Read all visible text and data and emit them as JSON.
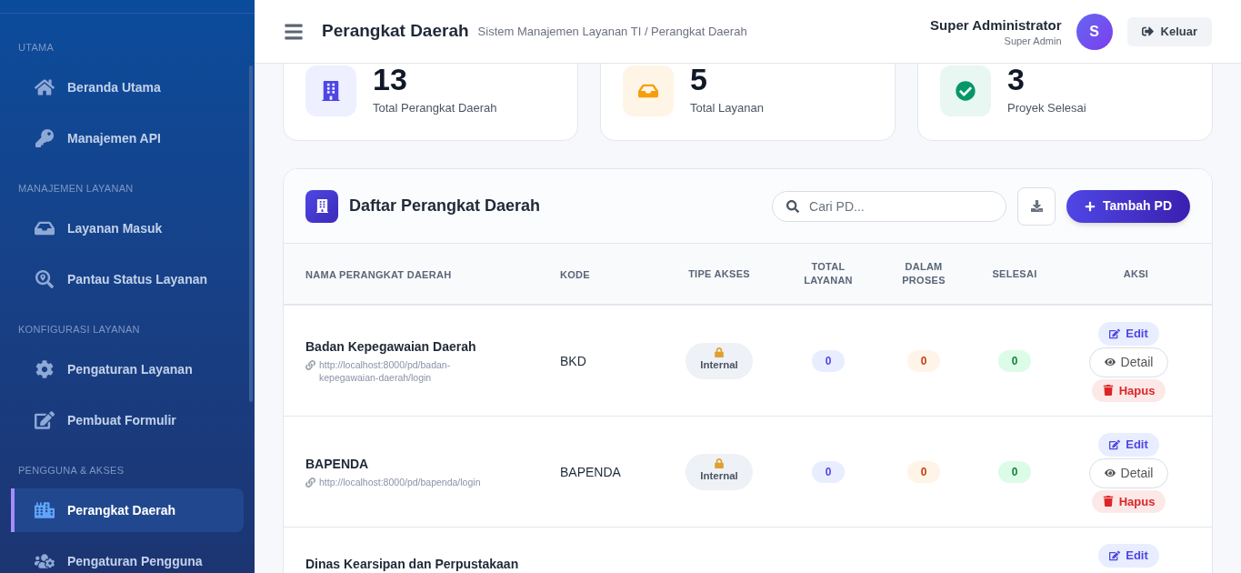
{
  "sidebar": {
    "sections": [
      {
        "label": "UTAMA",
        "items": [
          {
            "label": "Beranda Utama",
            "selected": false
          },
          {
            "label": "Manajemen API",
            "selected": false
          }
        ]
      },
      {
        "label": "MANAJEMEN LAYANAN",
        "items": [
          {
            "label": "Layanan Masuk",
            "selected": false
          },
          {
            "label": "Pantau Status Layanan",
            "selected": false
          }
        ]
      },
      {
        "label": "KONFIGURASI LAYANAN",
        "items": [
          {
            "label": "Pengaturan Layanan",
            "selected": false
          },
          {
            "label": "Pembuat Formulir",
            "selected": false
          }
        ]
      },
      {
        "label": "PENGGUNA & AKSES",
        "items": [
          {
            "label": "Perangkat Daerah",
            "selected": true
          },
          {
            "label": "Pengaturan Pengguna",
            "selected": false
          }
        ]
      }
    ]
  },
  "header": {
    "title": "Perangkat Daerah",
    "breadcrumb": "Sistem Manajemen Layanan TI / Perangkat Daerah",
    "user_name": "Super Administrator",
    "user_role": "Super Admin",
    "avatar": "S",
    "logout": "Keluar"
  },
  "stats": [
    {
      "value": "13",
      "label": "Total Perangkat Daerah"
    },
    {
      "value": "5",
      "label": "Total Layanan"
    },
    {
      "value": "3",
      "label": "Proyek Selesai"
    }
  ],
  "panel": {
    "title": "Daftar Perangkat Daerah",
    "search": {
      "placeholder": "Cari PD..."
    },
    "add_button": "Tambah PD",
    "columns": [
      "NAMA PERANGKAT DAERAH",
      "KODE",
      "TIPE AKSES",
      "TOTAL LAYANAN",
      "DALAM PROSES",
      "SELESAI",
      "AKSI"
    ],
    "rows": [
      {
        "name": "Badan Kepegawaian Daerah",
        "url": "http://localhost:8000/pd/badan-kepegawaian-daerah/login",
        "code": "BKD",
        "access": "Internal",
        "total": "0",
        "in_progress": "0",
        "done": "0",
        "actions": [
          {
            "kind": "edit",
            "label": "Edit"
          },
          {
            "kind": "detail",
            "label": "Detail"
          },
          {
            "kind": "delete",
            "label": "Hapus"
          }
        ]
      },
      {
        "name": "BAPENDA",
        "url": "http://localhost:8000/pd/bapenda/login",
        "code": "BAPENDA",
        "access": "Internal",
        "total": "0",
        "in_progress": "0",
        "done": "0",
        "actions": [
          {
            "kind": "edit",
            "label": "Edit"
          },
          {
            "kind": "detail",
            "label": "Detail"
          },
          {
            "kind": "delete",
            "label": "Hapus"
          }
        ]
      },
      {
        "name": "Dinas Kearsipan dan Perpustakaan",
        "actions": [
          {
            "kind": "edit",
            "label": "Edit"
          }
        ]
      }
    ]
  }
}
